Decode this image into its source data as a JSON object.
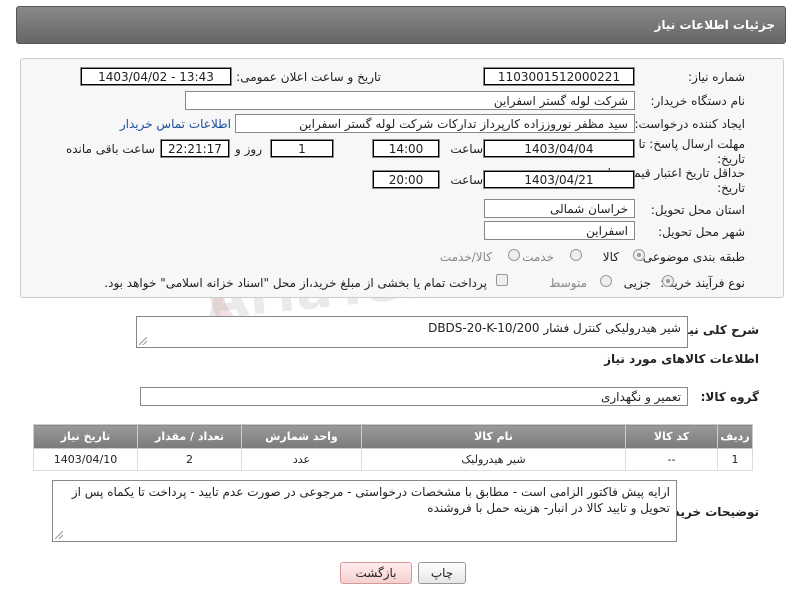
{
  "header": {
    "title": "جزئیات اطلاعات نیاز"
  },
  "fields": {
    "need_number": {
      "label": "شماره نیاز:",
      "value": "1103001512000221"
    },
    "announce_datetime": {
      "label": "تاریخ و ساعت اعلان عمومی:",
      "value": "1403/04/02 - 13:43"
    },
    "buyer_org": {
      "label": "نام دستگاه خریدار:",
      "value": "شرکت لوله گستر اسفراین"
    },
    "requester": {
      "label": "ایجاد کننده درخواست:",
      "value": "سید مظفر نوروززاده کارپرداز تدارکات شرکت لوله گستر اسفراین",
      "contact_link": "اطلاعات تماس خریدار"
    },
    "reply_deadline": {
      "label_line1": "مهلت ارسال پاسخ: تا",
      "label_line2": "تاریخ:",
      "date": "1403/04/04",
      "time_label": "ساعت",
      "time": "14:00",
      "days": "1",
      "days_label": "روز و",
      "remaining": "22:21:17",
      "remaining_label": "ساعت باقی مانده"
    },
    "price_validity": {
      "label_line1": "حداقل تاریخ اعتبار قیمت: تا",
      "label_line2": "تاریخ:",
      "date": "1403/04/21",
      "time_label": "ساعت",
      "time": "20:00"
    },
    "delivery_province": {
      "label": "استان محل تحویل:",
      "value": "خراسان شمالی"
    },
    "delivery_city": {
      "label": "شهر محل تحویل:",
      "value": "اسفراین"
    },
    "category": {
      "label": "طبقه بندی موضوعی:",
      "options": [
        "کالا",
        "خدمت",
        "کالا/خدمت"
      ],
      "selected": "کالا"
    },
    "purchase_process": {
      "label": "نوع فرآیند خرید :",
      "options": [
        "جزیی",
        "متوسط"
      ],
      "selected": "جزیی",
      "payment_note": "پرداخت تمام یا بخشی از مبلغ خرید،از محل \"اسناد خزانه اسلامی\" خواهد بود."
    }
  },
  "description": {
    "label": "شرح کلی نیاز:",
    "value": "شیر هیدرولیکی کنترل فشار DBDS-20-K-10/200"
  },
  "goods_section": {
    "title": "اطلاعات کالاهای مورد نیاز",
    "group_label": "گروه کالا:",
    "group_value": "تعمیر و نگهداری",
    "columns": [
      "ردیف",
      "کد کالا",
      "نام کالا",
      "واحد شمارش",
      "تعداد / مقدار",
      "تاریخ نیاز"
    ],
    "rows": [
      {
        "row": "1",
        "code": "--",
        "name": "شیر هیدرولیک",
        "unit": "عدد",
        "qty": "2",
        "date": "1403/04/10"
      }
    ]
  },
  "buyer_notes": {
    "label": "توضیحات خریدار:",
    "value": "ارایه پیش فاکتور الزامی است - مطابق با مشخصات درخواستی - مرجوعی در صورت عدم تایید - پرداخت تا یکماه پس از تحویل و تایید کالا در انبار- هزینه حمل با فروشنده"
  },
  "buttons": {
    "print": "چاپ",
    "back": "بازگشت"
  },
  "watermark": "AriaTender.neT"
}
